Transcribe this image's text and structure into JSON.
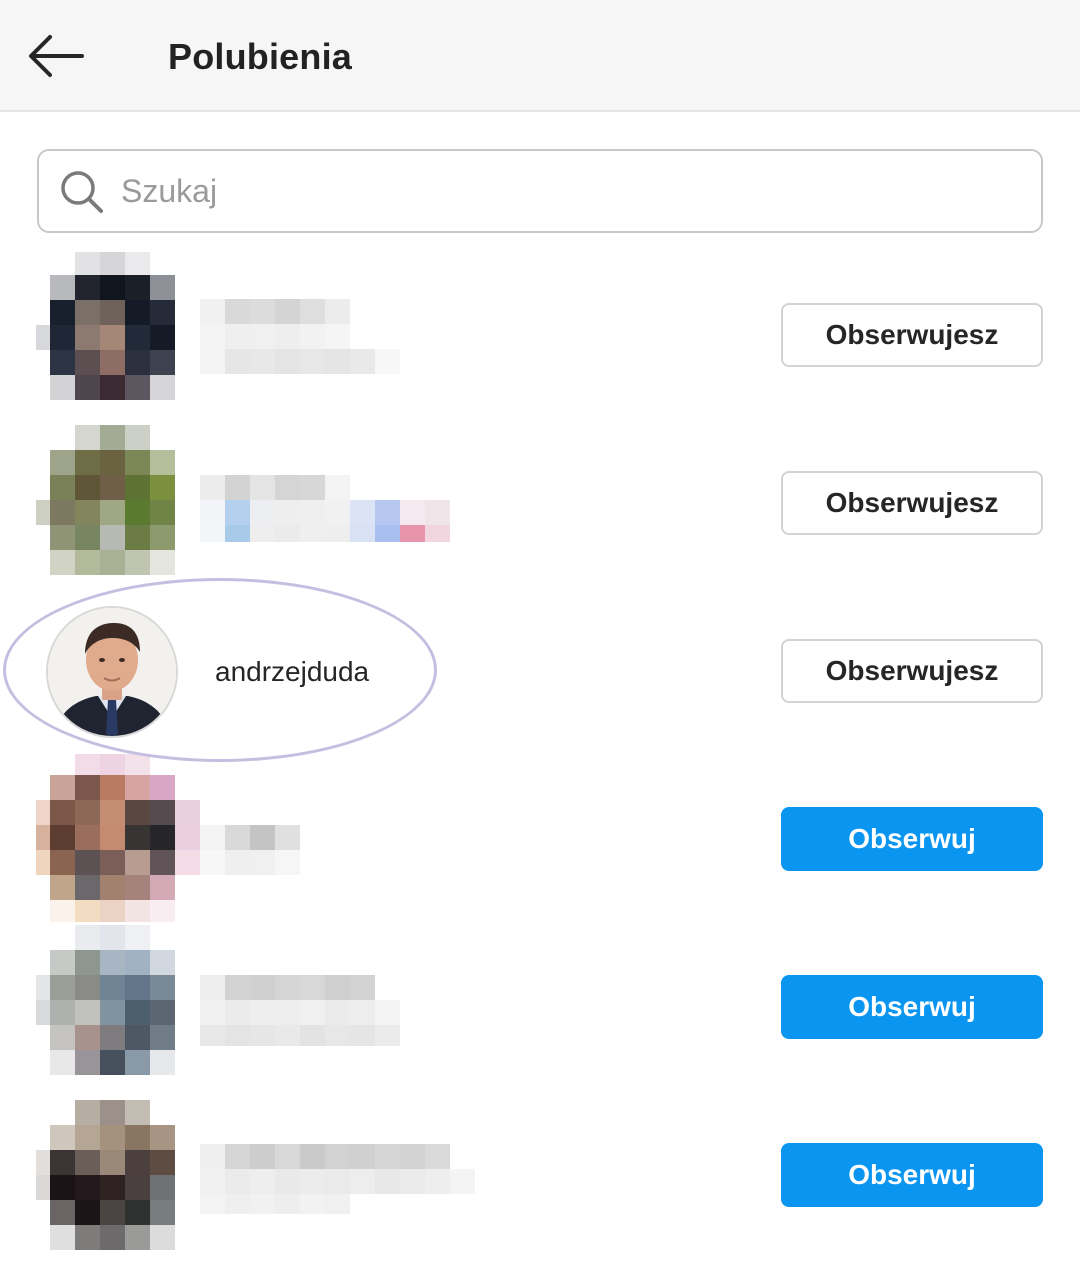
{
  "header": {
    "title": "Polubienia"
  },
  "search": {
    "placeholder": "Szukaj",
    "value": ""
  },
  "rows": [
    {
      "username": "",
      "button": "Obserwujesz",
      "following": true
    },
    {
      "username": "",
      "button": "Obserwujesz",
      "following": true
    },
    {
      "username": "andrzejduda",
      "button": "Obserwujesz",
      "following": true
    },
    {
      "username": "",
      "button": "Obserwuj",
      "following": false
    },
    {
      "username": "",
      "button": "Obserwuj",
      "following": false
    },
    {
      "username": "",
      "button": "Obserwuj",
      "following": false
    }
  ],
  "colors": {
    "follow_blue": "#0a95f0",
    "highlight_ring": "#c4bfe0"
  }
}
